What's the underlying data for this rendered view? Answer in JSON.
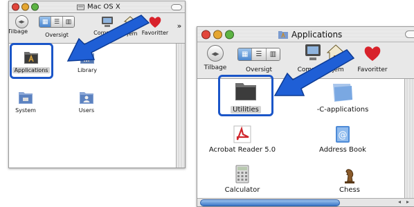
{
  "left_window": {
    "title": "Mac OS X",
    "toolbar": {
      "back": "Tilbage",
      "view": "Oversigt",
      "computer": "Computer",
      "home": "Hjem",
      "favorites": "Favoritter",
      "more": "»"
    },
    "items": [
      {
        "label": "Applications",
        "icon": "applications-folder-icon",
        "selected": true
      },
      {
        "label": "Library",
        "icon": "library-folder-icon"
      },
      {
        "label": "System",
        "icon": "system-folder-icon"
      },
      {
        "label": "Users",
        "icon": "users-folder-icon"
      }
    ]
  },
  "right_window": {
    "title": "Applications",
    "toolbar": {
      "back": "Tilbage",
      "view": "Oversigt",
      "computer": "Computer",
      "home": "Hjem",
      "favorites": "Favoritter"
    },
    "items": [
      {
        "label": "Utilities",
        "icon": "utilities-folder-icon",
        "selected": true
      },
      {
        "label": "-C-applications",
        "icon": "folder-icon"
      },
      {
        "label": "Acrobat Reader 5.0",
        "icon": "acrobat-icon"
      },
      {
        "label": "Address Book",
        "icon": "address-book-icon"
      },
      {
        "label": "Calculator",
        "icon": "calculator-icon"
      },
      {
        "label": "Chess",
        "icon": "chess-icon"
      }
    ]
  },
  "colors": {
    "highlight": "#1a55c8",
    "selection": "#d3d3d3",
    "close": "#e2463b",
    "minimize": "#e5a630",
    "zoom": "#5cb443"
  }
}
